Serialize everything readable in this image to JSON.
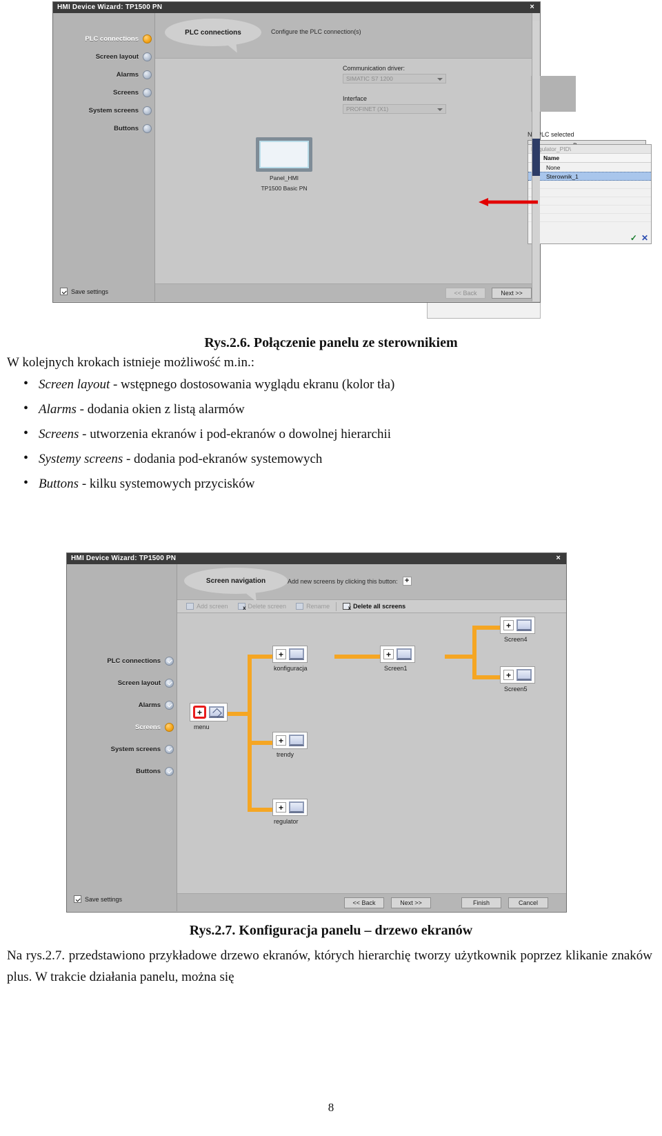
{
  "dialog1": {
    "title": "HMI Device Wizard: TP1500 PN",
    "close_label": "×",
    "bubble": "PLC connections",
    "subtitle": "Configure the PLC connection(s)",
    "nav": [
      {
        "label": "PLC connections",
        "state": "current"
      },
      {
        "label": "Screen layout",
        "state": "pending"
      },
      {
        "label": "Alarms",
        "state": "pending"
      },
      {
        "label": "Screens",
        "state": "pending"
      },
      {
        "label": "System screens",
        "state": "pending"
      },
      {
        "label": "Buttons",
        "state": "pending"
      }
    ],
    "save_settings_label": "Save settings",
    "panel": {
      "name": "Panel_HMI",
      "type": "TP1500 Basic PN"
    },
    "fields": [
      {
        "label": "Communication driver:",
        "value": "SIMATIC S7 1200"
      },
      {
        "label": "Interface",
        "value": "PROFINET (X1)"
      }
    ],
    "plc": {
      "status": "No PLC selected",
      "browse_label": "Browse ...",
      "dropdown": {
        "path": "Regulator_PID\\",
        "column": "Name",
        "rows": [
          {
            "label": "None",
            "selected": false,
            "icon": false
          },
          {
            "label": "Sterownik_1",
            "selected": true,
            "icon": true
          }
        ],
        "confirm_icon": "check-icon",
        "cancel_icon": "cross-icon"
      }
    },
    "buttons": {
      "back": "<< Back",
      "next": "Next >>"
    }
  },
  "doc": {
    "fig1_caption": "Rys.2.6. Połączenie panelu ze sterownikiem",
    "intro": "W kolejnych krokach istnieje możliwość m.in.:",
    "bullets": [
      {
        "term": "Screen layout",
        "rest": " - wstępnego dostosowania wyglądu ekranu (kolor tła)"
      },
      {
        "term": "Alarms",
        "rest": " - dodania okien z listą alarmów"
      },
      {
        "term": "Screens",
        "rest": " - utworzenia ekranów i pod-ekranów o dowolnej hierarchii"
      },
      {
        "term": "Systemy screens",
        "rest": " - dodania pod-ekranów systemowych"
      },
      {
        "term": "Buttons",
        "rest": " - kilku systemowych przycisków"
      }
    ],
    "fig2_caption": "Rys.2.7. Konfiguracja panelu – drzewo ekranów",
    "closing": "Na rys.2.7. przedstawiono przykładowe drzewo ekranów, których hierarchię tworzy użytkownik poprzez klikanie znaków plus. W trakcie działania panelu, można się",
    "page_number": "8"
  },
  "dialog2": {
    "title": "HMI Device Wizard: TP1500 PN",
    "close_label": "×",
    "bubble": "Screen navigation",
    "subtitle": "Add new screens by clicking this button:",
    "add_button_glyph": "+",
    "nav": [
      {
        "label": "PLC connections",
        "state": "done"
      },
      {
        "label": "Screen layout",
        "state": "done"
      },
      {
        "label": "Alarms",
        "state": "done"
      },
      {
        "label": "Screens",
        "state": "current"
      },
      {
        "label": "System screens",
        "state": "done"
      },
      {
        "label": "Buttons",
        "state": "done"
      }
    ],
    "save_settings_label": "Save settings",
    "toolbar": [
      {
        "label": "Add screen",
        "enabled": false
      },
      {
        "label": "Delete screen",
        "enabled": false
      },
      {
        "label": "Rename",
        "enabled": false
      },
      {
        "label": "Delete all screens",
        "enabled": true
      }
    ],
    "tree": {
      "nodes": [
        {
          "id": "menu",
          "label": "menu",
          "kind": "home"
        },
        {
          "id": "konfiguracja",
          "label": "konfiguracja",
          "kind": "screen"
        },
        {
          "id": "screen1",
          "label": "Screen1",
          "kind": "screen"
        },
        {
          "id": "screen4",
          "label": "Screen4",
          "kind": "screen"
        },
        {
          "id": "screen5",
          "label": "Screen5",
          "kind": "screen"
        },
        {
          "id": "trendy",
          "label": "trendy",
          "kind": "screen"
        },
        {
          "id": "regulator",
          "label": "regulator",
          "kind": "screen"
        }
      ],
      "plus_glyph": "+"
    },
    "buttons": {
      "back": "<< Back",
      "next": "Next >>",
      "finish": "Finish",
      "cancel": "Cancel"
    }
  },
  "colors": {
    "accent_orange": "#f5a623",
    "current_step": "#f6a81e",
    "titlebar": "#3b3b3b",
    "dialog_bg": "#c0c0c0",
    "selection_blue": "#a9c6ec",
    "home_node_red": "#e81c1c",
    "arrow_red": "#e20000"
  }
}
